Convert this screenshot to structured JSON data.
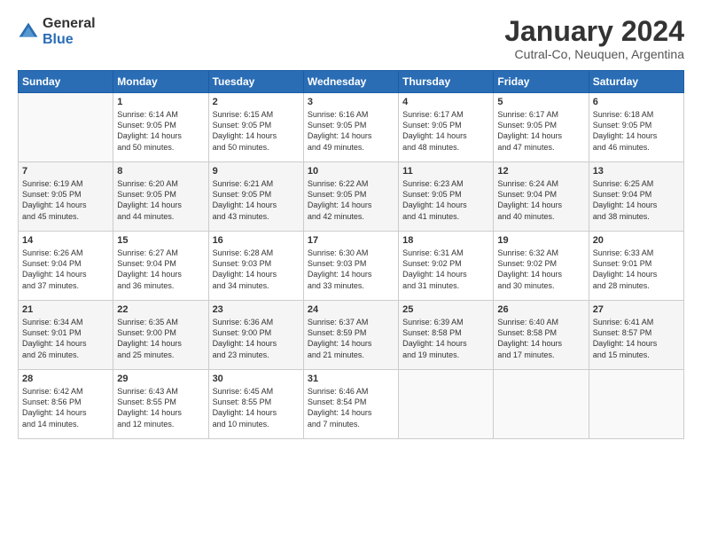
{
  "logo": {
    "general": "General",
    "blue": "Blue"
  },
  "title": "January 2024",
  "location": "Cutral-Co, Neuquen, Argentina",
  "days_header": [
    "Sunday",
    "Monday",
    "Tuesday",
    "Wednesday",
    "Thursday",
    "Friday",
    "Saturday"
  ],
  "weeks": [
    [
      {
        "num": "",
        "info": ""
      },
      {
        "num": "1",
        "info": "Sunrise: 6:14 AM\nSunset: 9:05 PM\nDaylight: 14 hours\nand 50 minutes."
      },
      {
        "num": "2",
        "info": "Sunrise: 6:15 AM\nSunset: 9:05 PM\nDaylight: 14 hours\nand 50 minutes."
      },
      {
        "num": "3",
        "info": "Sunrise: 6:16 AM\nSunset: 9:05 PM\nDaylight: 14 hours\nand 49 minutes."
      },
      {
        "num": "4",
        "info": "Sunrise: 6:17 AM\nSunset: 9:05 PM\nDaylight: 14 hours\nand 48 minutes."
      },
      {
        "num": "5",
        "info": "Sunrise: 6:17 AM\nSunset: 9:05 PM\nDaylight: 14 hours\nand 47 minutes."
      },
      {
        "num": "6",
        "info": "Sunrise: 6:18 AM\nSunset: 9:05 PM\nDaylight: 14 hours\nand 46 minutes."
      }
    ],
    [
      {
        "num": "7",
        "info": "Sunrise: 6:19 AM\nSunset: 9:05 PM\nDaylight: 14 hours\nand 45 minutes."
      },
      {
        "num": "8",
        "info": "Sunrise: 6:20 AM\nSunset: 9:05 PM\nDaylight: 14 hours\nand 44 minutes."
      },
      {
        "num": "9",
        "info": "Sunrise: 6:21 AM\nSunset: 9:05 PM\nDaylight: 14 hours\nand 43 minutes."
      },
      {
        "num": "10",
        "info": "Sunrise: 6:22 AM\nSunset: 9:05 PM\nDaylight: 14 hours\nand 42 minutes."
      },
      {
        "num": "11",
        "info": "Sunrise: 6:23 AM\nSunset: 9:05 PM\nDaylight: 14 hours\nand 41 minutes."
      },
      {
        "num": "12",
        "info": "Sunrise: 6:24 AM\nSunset: 9:04 PM\nDaylight: 14 hours\nand 40 minutes."
      },
      {
        "num": "13",
        "info": "Sunrise: 6:25 AM\nSunset: 9:04 PM\nDaylight: 14 hours\nand 38 minutes."
      }
    ],
    [
      {
        "num": "14",
        "info": "Sunrise: 6:26 AM\nSunset: 9:04 PM\nDaylight: 14 hours\nand 37 minutes."
      },
      {
        "num": "15",
        "info": "Sunrise: 6:27 AM\nSunset: 9:04 PM\nDaylight: 14 hours\nand 36 minutes."
      },
      {
        "num": "16",
        "info": "Sunrise: 6:28 AM\nSunset: 9:03 PM\nDaylight: 14 hours\nand 34 minutes."
      },
      {
        "num": "17",
        "info": "Sunrise: 6:30 AM\nSunset: 9:03 PM\nDaylight: 14 hours\nand 33 minutes."
      },
      {
        "num": "18",
        "info": "Sunrise: 6:31 AM\nSunset: 9:02 PM\nDaylight: 14 hours\nand 31 minutes."
      },
      {
        "num": "19",
        "info": "Sunrise: 6:32 AM\nSunset: 9:02 PM\nDaylight: 14 hours\nand 30 minutes."
      },
      {
        "num": "20",
        "info": "Sunrise: 6:33 AM\nSunset: 9:01 PM\nDaylight: 14 hours\nand 28 minutes."
      }
    ],
    [
      {
        "num": "21",
        "info": "Sunrise: 6:34 AM\nSunset: 9:01 PM\nDaylight: 14 hours\nand 26 minutes."
      },
      {
        "num": "22",
        "info": "Sunrise: 6:35 AM\nSunset: 9:00 PM\nDaylight: 14 hours\nand 25 minutes."
      },
      {
        "num": "23",
        "info": "Sunrise: 6:36 AM\nSunset: 9:00 PM\nDaylight: 14 hours\nand 23 minutes."
      },
      {
        "num": "24",
        "info": "Sunrise: 6:37 AM\nSunset: 8:59 PM\nDaylight: 14 hours\nand 21 minutes."
      },
      {
        "num": "25",
        "info": "Sunrise: 6:39 AM\nSunset: 8:58 PM\nDaylight: 14 hours\nand 19 minutes."
      },
      {
        "num": "26",
        "info": "Sunrise: 6:40 AM\nSunset: 8:58 PM\nDaylight: 14 hours\nand 17 minutes."
      },
      {
        "num": "27",
        "info": "Sunrise: 6:41 AM\nSunset: 8:57 PM\nDaylight: 14 hours\nand 15 minutes."
      }
    ],
    [
      {
        "num": "28",
        "info": "Sunrise: 6:42 AM\nSunset: 8:56 PM\nDaylight: 14 hours\nand 14 minutes."
      },
      {
        "num": "29",
        "info": "Sunrise: 6:43 AM\nSunset: 8:55 PM\nDaylight: 14 hours\nand 12 minutes."
      },
      {
        "num": "30",
        "info": "Sunrise: 6:45 AM\nSunset: 8:55 PM\nDaylight: 14 hours\nand 10 minutes."
      },
      {
        "num": "31",
        "info": "Sunrise: 6:46 AM\nSunset: 8:54 PM\nDaylight: 14 hours\nand 7 minutes."
      },
      {
        "num": "",
        "info": ""
      },
      {
        "num": "",
        "info": ""
      },
      {
        "num": "",
        "info": ""
      }
    ]
  ]
}
